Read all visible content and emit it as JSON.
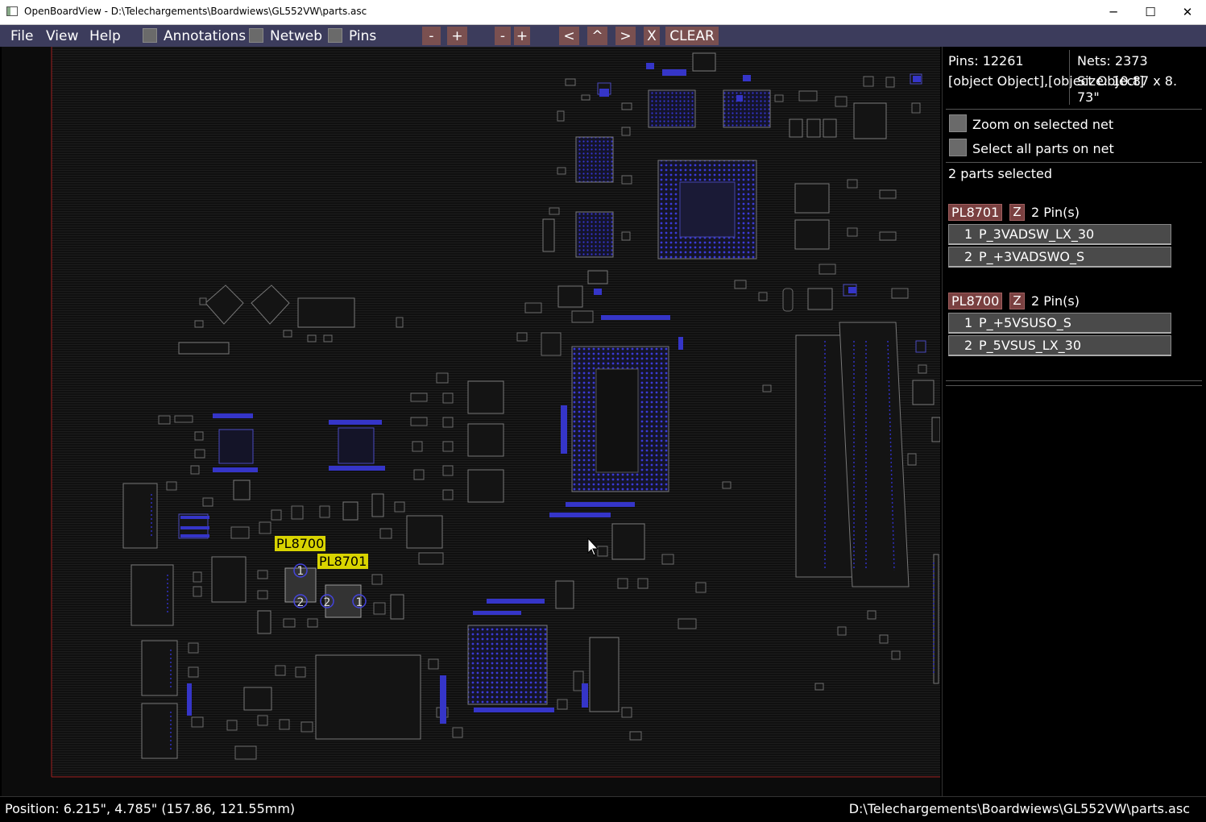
{
  "window": {
    "title": "OpenBoardView - D:\\Telechargements\\Boardwiews\\GL552VW\\parts.asc",
    "min_glyph": "─",
    "max_glyph": "☐",
    "close_glyph": "✕"
  },
  "menu": {
    "file": "File",
    "view": "View",
    "help": "Help",
    "annotations": "Annotations",
    "netweb": "Netweb",
    "pins": "Pins",
    "toolbar": [
      "-",
      "+",
      "-",
      "+",
      "<",
      "^",
      ">",
      "X",
      "CLEAR"
    ]
  },
  "board": {
    "labels": [
      {
        "text": "PL8700"
      },
      {
        "text": "PL8701"
      }
    ],
    "pin_numbers": [
      "1",
      "2",
      "2",
      "1"
    ]
  },
  "sidebar": {
    "pins": "Pins: 12261",
    "parts": [
      {
        "name": "PL8701",
        "z": "Z",
        "pin_count": "2 Pin(s)",
        "pins": [
          {
            "num": "1",
            "net": "P_3VADSW_LX_30"
          },
          {
            "num": "2",
            "net": "P_+3VADSWO_S"
          }
        ]
      },
      {
        "name": "PL8700",
        "z": "Z",
        "pin_count": "2 Pin(s)",
        "pins": [
          {
            "num": "1",
            "net": "P_+5VSUSO_S"
          },
          {
            "num": "2",
            "net": "P_5VSUS_LX_30"
          }
        ]
      }
    ],
    "nets": "Nets: 2373",
    "size_line1": "Size: 10.87 x 8.",
    "size_line2": "73\"",
    "zoom_selected_net": "Zoom on selected net",
    "select_all_parts": "Select all parts on net",
    "parts_selected": "2 parts selected"
  },
  "status": {
    "position": "Position: 6.215\", 4.785\" (157.86, 121.55mm)",
    "file": "D:\\Telechargements\\Boardwiews\\GL552VW\\parts.asc"
  },
  "colors": {
    "menubar": "#3c3c5c",
    "button": "#7a5050",
    "pad_blue": "#3333cc",
    "outline": "#777777",
    "board_edge": "#a02020",
    "highlight": "#d9d400"
  }
}
